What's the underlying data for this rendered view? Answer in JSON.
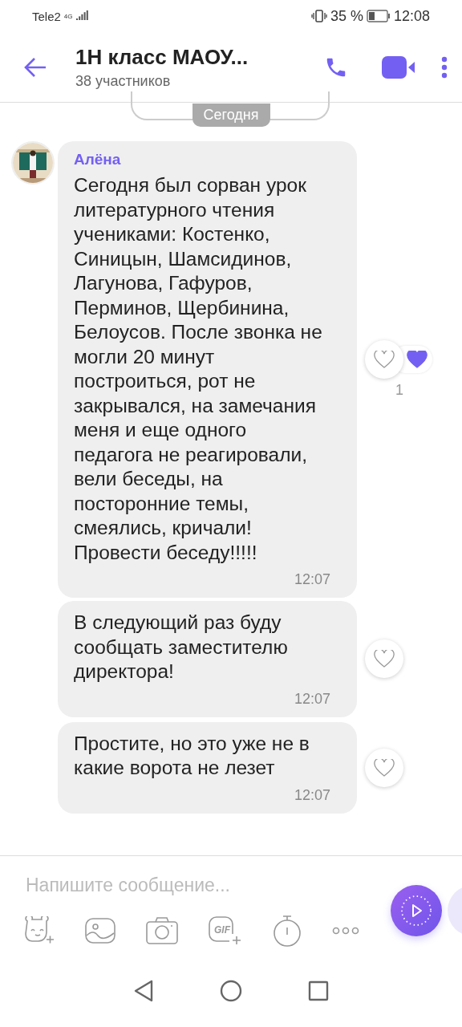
{
  "status_bar": {
    "carrier": "Tele2",
    "network": "4G",
    "battery_percent": "35 %",
    "time": "12:08"
  },
  "header": {
    "title": "1Н класс МАОУ...",
    "subtitle": "38 участников"
  },
  "date_chip": "Сегодня",
  "messages": [
    {
      "kind": "first",
      "sender": "Алёна",
      "text": "Сегодня был сорван урок литературного чтения учениками: Костенко, Синицын, Шамсидинов, Лагунова, Гафуров, Перминов, Щербинина, Белоусов. После звонка не могли 20 минут построиться, рот не закрывался, на замечания меня и еще одного педагога не реагировали, вели беседы, на посторонние темы, смеялись, кричали! Провести беседу!!!!!",
      "time": "12:07",
      "liked": false,
      "likes": "1"
    },
    {
      "kind": "follow",
      "text": "В следующий раз буду сообщать заместителю директора!",
      "time": "12:07",
      "liked": false
    },
    {
      "kind": "follow",
      "text": "Простите, но это уже не в какие ворота не лезет",
      "time": "12:07",
      "liked": false
    }
  ],
  "composer": {
    "placeholder": "Напишите сообщение...",
    "gif_label": "GIF"
  }
}
